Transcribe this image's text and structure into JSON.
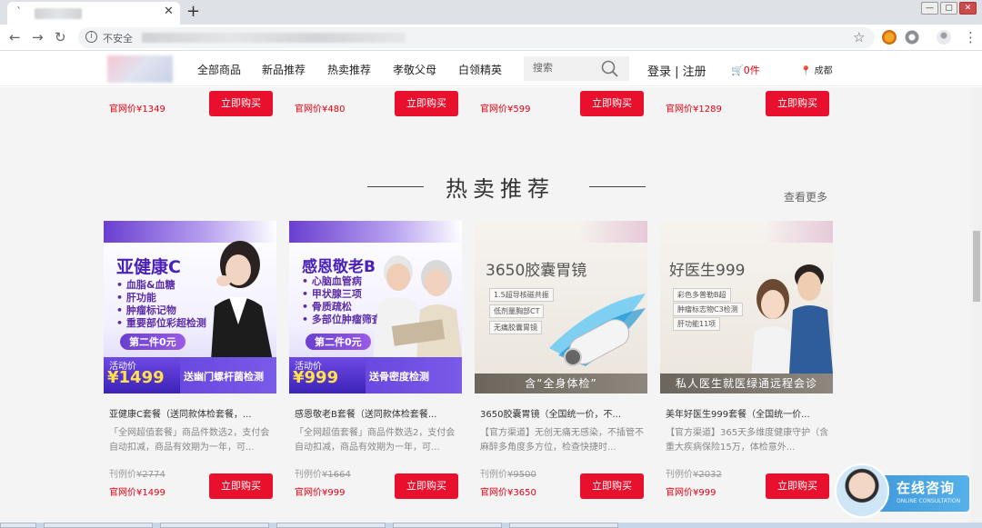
{
  "browser": {
    "insecure_label": "不安全",
    "new_tab": "+",
    "tab_close": "✕",
    "window_controls": [
      "—",
      "▢",
      "✕"
    ]
  },
  "nav": {
    "items": [
      "全部商品",
      "新品推荐",
      "热卖推荐",
      "孝敬父母",
      "白领精英"
    ],
    "search_placeholder": "搜索",
    "login": "登录 | 注册",
    "cart": "0件",
    "location": "成都"
  },
  "prev_row": {
    "items": [
      {
        "price": "官网价¥1349",
        "button": "立即购买"
      },
      {
        "price": "官网价¥480",
        "button": "立即购买"
      },
      {
        "price": "官网价¥599",
        "button": "立即购买"
      },
      {
        "price": "官网价¥1289",
        "button": "立即购买"
      }
    ]
  },
  "section": {
    "title": "热卖推荐",
    "more": "查看更多"
  },
  "products": [
    {
      "img_title": "亚健康C",
      "img_bullets": [
        "• 血脂&血糖",
        "• 肝功能",
        "• 肿瘤标记物",
        "• 重要部位彩超检测"
      ],
      "pill": "第二件0元",
      "promo_tag": "活动价",
      "promo_price": "¥1499",
      "promo_text": "送幽门螺杆菌检测",
      "name": "亚健康C套餐（送同款体检套餐，...",
      "desc": "「全网超值套餐」商品件数选2，支付会自动扣减，商品有效期为一年，可...",
      "ref_label": "刊例价",
      "ref_price": "¥2774",
      "price": "官网价¥1499",
      "button": "立即购买"
    },
    {
      "img_title": "感恩敬老B",
      "img_bullets": [
        "• 心脑血管病",
        "• 甲状腺三项",
        "• 骨质疏松",
        "• 多部位肿瘤筛查"
      ],
      "pill": "第二件0元",
      "promo_tag": "活动价",
      "promo_price": "¥999",
      "promo_text": "送骨密度检测",
      "name": "感恩敬老B套餐（送同款体检套餐...",
      "desc": "「全网超值套餐」商品件数选2，支付会自动扣减，商品有效期为一年，可...",
      "ref_label": "刊例价",
      "ref_price": "¥1664",
      "price": "官网价¥999",
      "button": "立即购买"
    },
    {
      "img_title": "3650胶囊胃镜",
      "img_features": [
        "1.5超导核磁共振",
        "低剂量胸部CT",
        "无痛胶囊胃镜"
      ],
      "band": "含“全身体检”",
      "name": "3650胶囊胃镜（全国统一价，不...",
      "desc": "【官方渠道】无创无痛无感染，不插管不麻醉多角度多方位，检查快捷时...",
      "ref_label": "刊例价",
      "ref_price": "¥9500",
      "price": "官网价¥3650",
      "button": "立即购买"
    },
    {
      "img_title": "好医生999",
      "img_features": [
        "彩色多普勒B超",
        "肿瘤标志物C3检测",
        "肝功能11项"
      ],
      "band": "私人医生就医绿通远程会诊",
      "name": "美年好医生999套餐（全国统一价...",
      "desc": "【官方渠道】365天多维度健康守护（含重大疾病保险15万，体检意外...",
      "ref_label": "刊例价",
      "ref_price": "¥2032",
      "price": "官网价¥999",
      "button": "立即购买"
    }
  ],
  "chat": {
    "title": "在线咨询",
    "subtitle": "ONLINE CONSULTATION"
  }
}
